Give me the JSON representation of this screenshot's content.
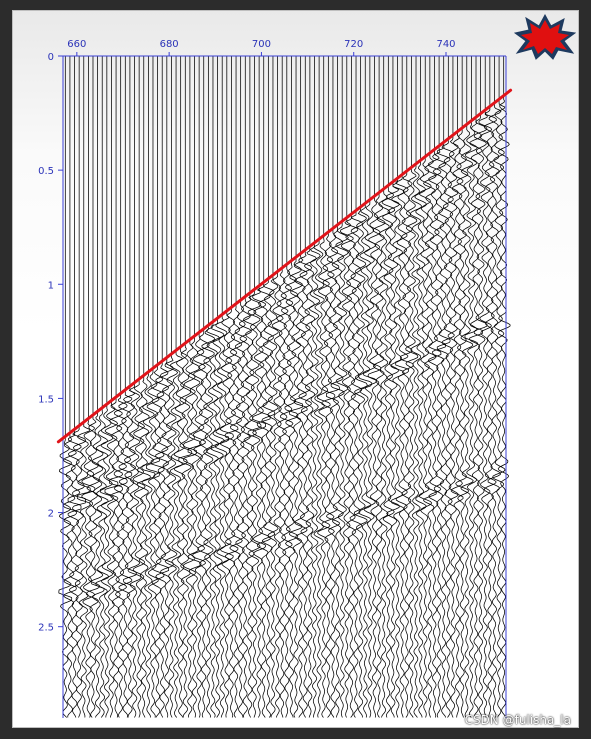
{
  "chart_data": {
    "type": "line",
    "title": "",
    "xlabel": "",
    "ylabel": "",
    "x_ticks": [
      "660",
      "680",
      "700",
      "720",
      "740"
    ],
    "y_ticks": [
      "0",
      "0.5",
      "1",
      "1.5",
      "2",
      "2.5"
    ],
    "x_tick_values": [
      660,
      680,
      700,
      720,
      740
    ],
    "y_tick_values": [
      0,
      0.5,
      1,
      1.5,
      2,
      2.5
    ],
    "xlim": [
      657,
      753
    ],
    "ylim": [
      0,
      2.9
    ],
    "trace_count": 96,
    "series": [
      {
        "x": [
          656,
          754
        ],
        "y": [
          1.69,
          0.15
        ]
      }
    ],
    "colors": {
      "axis": "#3a3fd6",
      "tick_label": "#2b33b8",
      "trace": "#000000",
      "pick_line": "#e0141a",
      "burst": "#e01010"
    }
  },
  "watermark": "CSDN @fulisha_la",
  "burst_icon": "red-starburst-icon"
}
